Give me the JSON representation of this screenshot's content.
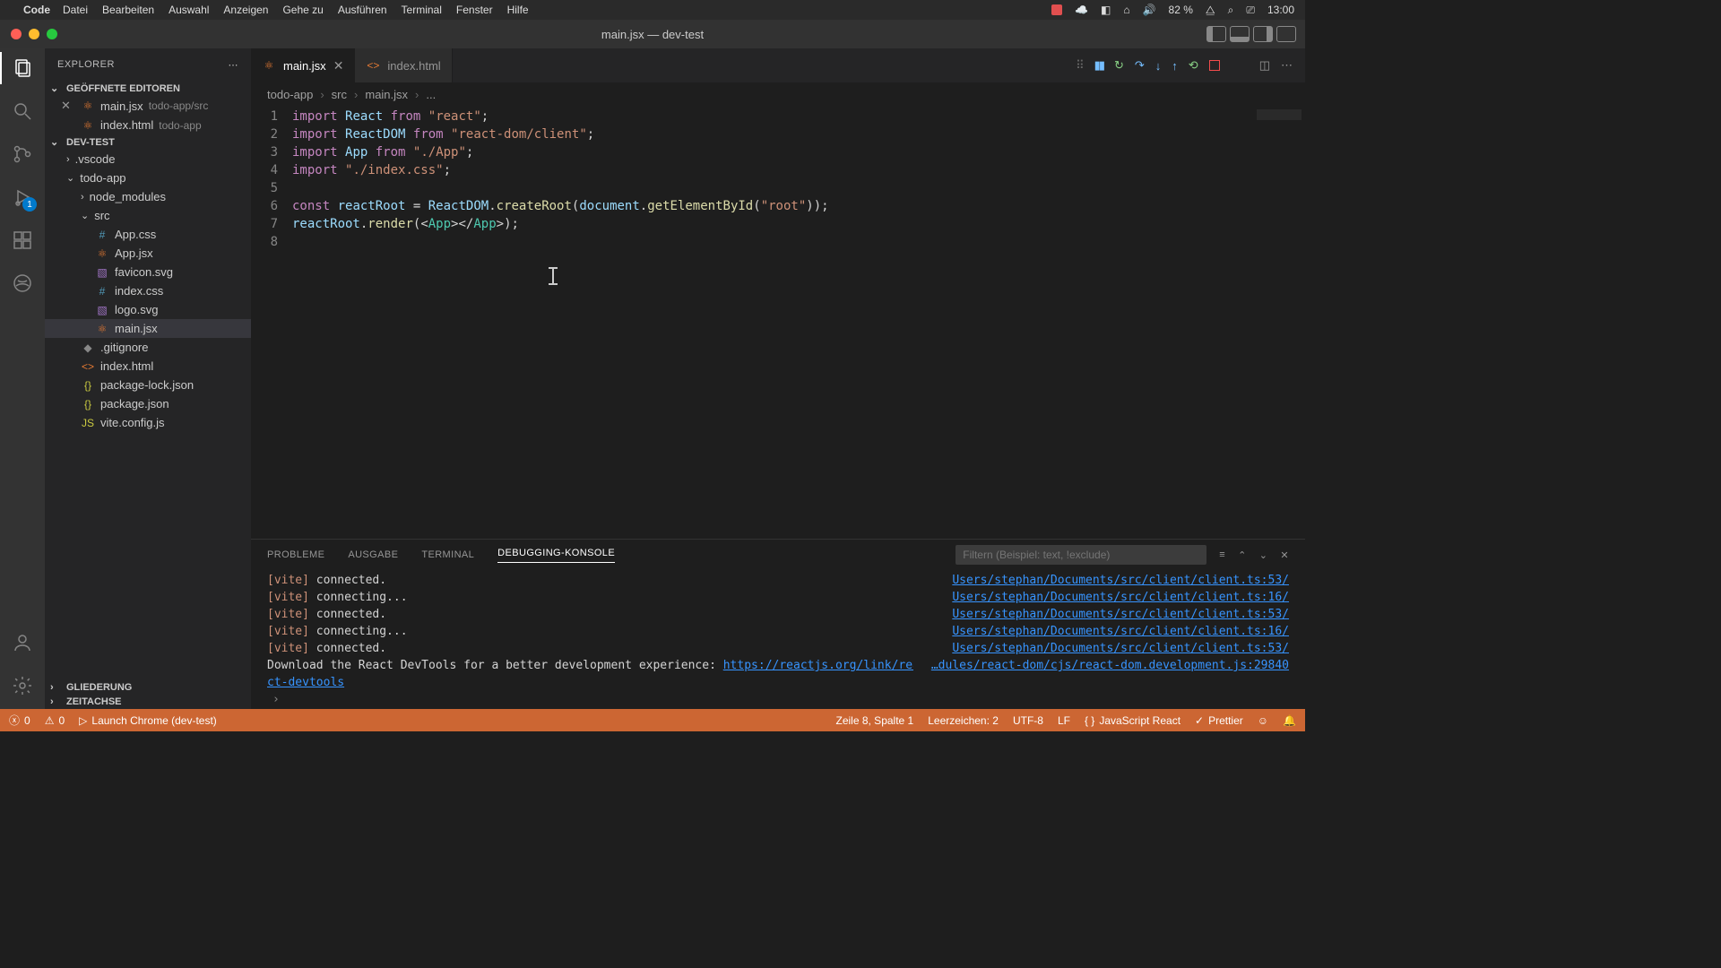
{
  "macos": {
    "app": "Code",
    "menus": [
      "Datei",
      "Bearbeiten",
      "Auswahl",
      "Anzeigen",
      "Gehe zu",
      "Ausführen",
      "Terminal",
      "Fenster",
      "Hilfe"
    ],
    "battery": "82 %",
    "clock": "13:00"
  },
  "window": {
    "title": "main.jsx — dev-test"
  },
  "activity": {
    "run_badge": "1"
  },
  "sidebar": {
    "title": "EXPLORER",
    "open_editors_label": "GEÖFFNETE EDITOREN",
    "open_editors": [
      {
        "name": "main.jsx",
        "hint": "todo-app/src",
        "closeable": true
      },
      {
        "name": "index.html",
        "hint": "todo-app",
        "closeable": false
      }
    ],
    "project": "DEV-TEST",
    "tree": [
      {
        "depth": 1,
        "kind": "folder-closed",
        "label": ".vscode"
      },
      {
        "depth": 1,
        "kind": "folder-open",
        "label": "todo-app"
      },
      {
        "depth": 2,
        "kind": "folder-closed",
        "label": "node_modules"
      },
      {
        "depth": 2,
        "kind": "folder-open",
        "label": "src"
      },
      {
        "depth": 3,
        "kind": "css",
        "label": "App.css"
      },
      {
        "depth": 3,
        "kind": "jsx-orange",
        "label": "App.jsx"
      },
      {
        "depth": 3,
        "kind": "svg",
        "label": "favicon.svg"
      },
      {
        "depth": 3,
        "kind": "css",
        "label": "index.css"
      },
      {
        "depth": 3,
        "kind": "svg",
        "label": "logo.svg"
      },
      {
        "depth": 3,
        "kind": "jsx-orange",
        "label": "main.jsx",
        "selected": true
      },
      {
        "depth": 2,
        "kind": "git",
        "label": ".gitignore"
      },
      {
        "depth": 2,
        "kind": "html",
        "label": "index.html"
      },
      {
        "depth": 2,
        "kind": "json",
        "label": "package-lock.json"
      },
      {
        "depth": 2,
        "kind": "json",
        "label": "package.json"
      },
      {
        "depth": 2,
        "kind": "js",
        "label": "vite.config.js"
      }
    ],
    "outline": "GLIEDERUNG",
    "timeline": "ZEITACHSE"
  },
  "tabs": [
    {
      "icon": "jsx",
      "label": "main.jsx",
      "active": true
    },
    {
      "icon": "html",
      "label": "index.html",
      "active": false
    }
  ],
  "breadcrumb": [
    "todo-app",
    "src",
    "main.jsx",
    "..."
  ],
  "code": {
    "lines": [
      {
        "n": 1,
        "html": "<span class='kw'>import</span> <span class='id'>React</span> <span class='kw'>from</span> <span class='str'>\"react\"</span>;"
      },
      {
        "n": 2,
        "html": "<span class='kw'>import</span> <span class='id'>ReactDOM</span> <span class='kw'>from</span> <span class='str'>\"react-dom/client\"</span>;"
      },
      {
        "n": 3,
        "html": "<span class='kw'>import</span> <span class='id'>App</span> <span class='kw'>from</span> <span class='str'>\"./App\"</span>;"
      },
      {
        "n": 4,
        "html": "<span class='kw'>import</span> <span class='str'>\"./index.css\"</span>;"
      },
      {
        "n": 5,
        "html": ""
      },
      {
        "n": 6,
        "html": "<span class='kw'>const</span> <span class='id'>reactRoot</span> = <span class='id'>ReactDOM</span>.<span class='fn'>createRoot</span>(<span class='id'>document</span>.<span class='fn'>getElementById</span>(<span class='str'>\"root\"</span>));"
      },
      {
        "n": 7,
        "html": "<span class='id'>reactRoot</span>.<span class='fn'>render</span>(<span class='punc'>&lt;</span><span class='tag'>App</span><span class='punc'>&gt;&lt;/</span><span class='tag'>App</span><span class='punc'>&gt;</span>);"
      },
      {
        "n": 8,
        "html": ""
      }
    ]
  },
  "panel": {
    "tabs": {
      "problems": "PROBLEME",
      "output": "AUSGABE",
      "terminal": "TERMINAL",
      "debug": "DEBUGGING-KONSOLE"
    },
    "filter_placeholder": "Filtern (Beispiel: text, !exclude)",
    "rows": [
      {
        "msg_prefix": "[vite]",
        "msg": " connected.",
        "src": "Users/stephan/Documents/src/client/client.ts:53/"
      },
      {
        "msg_prefix": "[vite]",
        "msg": " connecting...",
        "src": "Users/stephan/Documents/src/client/client.ts:16/"
      },
      {
        "msg_prefix": "[vite]",
        "msg": " connected.",
        "src": "Users/stephan/Documents/src/client/client.ts:53/"
      },
      {
        "msg_prefix": "[vite]",
        "msg": " connecting...",
        "src": "Users/stephan/Documents/src/client/client.ts:16/"
      },
      {
        "msg_prefix": "[vite]",
        "msg": " connected.",
        "src": "Users/stephan/Documents/src/client/client.ts:53/"
      }
    ],
    "devtools_pre": "Download the React DevTools for a better development experience: ",
    "devtools_link": "https://reactjs.org/link/rea",
    "devtools_tail": "ct-devtools",
    "devtools_src": "…dules/react-dom/cjs/react-dom.development.js:29840"
  },
  "status": {
    "errors": "0",
    "warnings": "0",
    "launch": "Launch Chrome (dev-test)",
    "pos": "Zeile 8, Spalte 1",
    "spaces": "Leerzeichen: 2",
    "encoding": "UTF-8",
    "eol": "LF",
    "lang": "JavaScript React",
    "prettier": "Prettier"
  }
}
